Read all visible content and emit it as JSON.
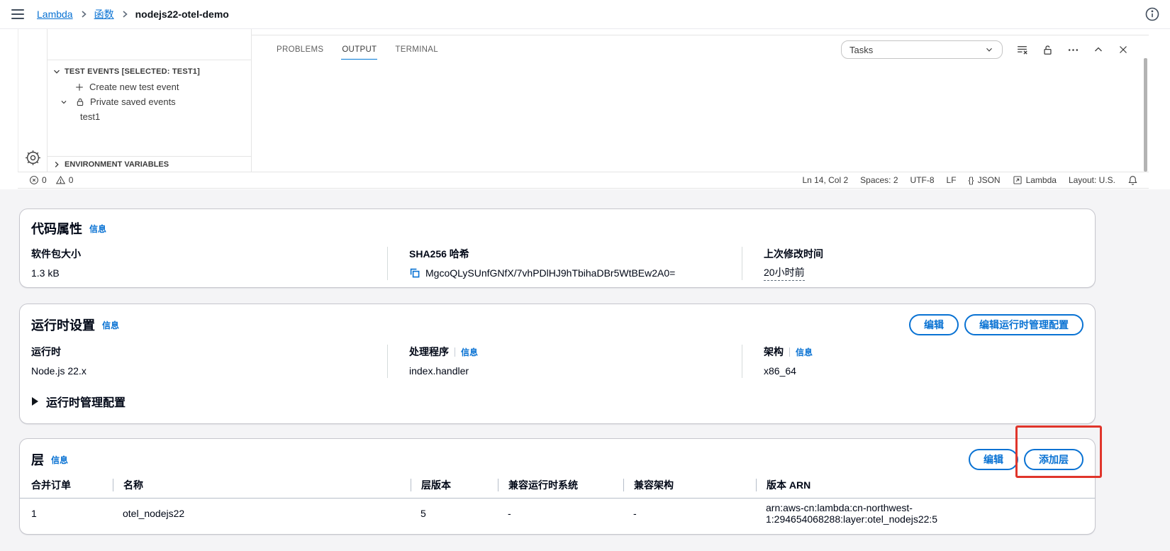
{
  "colors": {
    "accent_blue": "#0972d3",
    "annotation_red": "#e0352b",
    "tab_underline": "#0078d4"
  },
  "topbar": {
    "breadcrumb": [
      {
        "label": "Lambda"
      },
      {
        "label": "函数"
      },
      {
        "label": "nodejs22-otel-demo"
      }
    ]
  },
  "editor": {
    "sidebar": {
      "test_events_header": "TEST EVENTS [SELECTED: TEST1]",
      "create_new_test_event": "Create new test event",
      "private_saved_events": "Private saved events",
      "test_event_name": "test1",
      "environment_variables_header": "ENVIRONMENT VARIABLES"
    },
    "panel": {
      "tabs": [
        {
          "label": "PROBLEMS"
        },
        {
          "label": "OUTPUT"
        },
        {
          "label": "TERMINAL"
        }
      ],
      "active_tab": "OUTPUT",
      "tasks_dropdown_value": "Tasks"
    },
    "statusbar": {
      "error_count": "0",
      "warning_count": "0",
      "cursor_position": "Ln 14, Col 2",
      "indentation": "Spaces: 2",
      "encoding": "UTF-8",
      "eol": "LF",
      "language_icon": "{}",
      "language": "JSON",
      "extension": "Lambda",
      "layout": "Layout: U.S."
    }
  },
  "code_properties": {
    "title": "代码属性",
    "info_link": "信息",
    "package_size_label": "软件包大小",
    "package_size_value": "1.3 kB",
    "sha256_label": "SHA256 哈希",
    "sha256_value": "MgcoQLySUnfGNfX/7vhPDlHJ9hTbihaDBr5WtBEw2A0=",
    "last_modified_label": "上次修改时间",
    "last_modified_value": "20小时前"
  },
  "runtime_settings": {
    "title": "运行时设置",
    "info_link": "信息",
    "edit_button": "编辑",
    "edit_runtime_mgmt_button": "编辑运行时管理配置",
    "runtime_label": "运行时",
    "runtime_value": "Node.js 22.x",
    "handler_label": "处理程序",
    "handler_info": "信息",
    "handler_value": "index.handler",
    "architecture_label": "架构",
    "architecture_info": "信息",
    "architecture_value": "x86_64",
    "runtime_mgmt_toggle": "运行时管理配置"
  },
  "layers": {
    "title": "层",
    "info_link": "信息",
    "edit_button": "编辑",
    "add_layer_button": "添加层",
    "columns": [
      "合并订单",
      "名称",
      "层版本",
      "兼容运行时系统",
      "兼容架构",
      "版本 ARN"
    ],
    "rows": [
      {
        "merge_order": "1",
        "name": "otel_nodejs22",
        "version": "5",
        "compatible_runtimes": "-",
        "compatible_architectures": "-",
        "arn": "arn:aws-cn:lambda:cn-northwest-1:294654068288:layer:otel_nodejs22:5"
      }
    ]
  }
}
